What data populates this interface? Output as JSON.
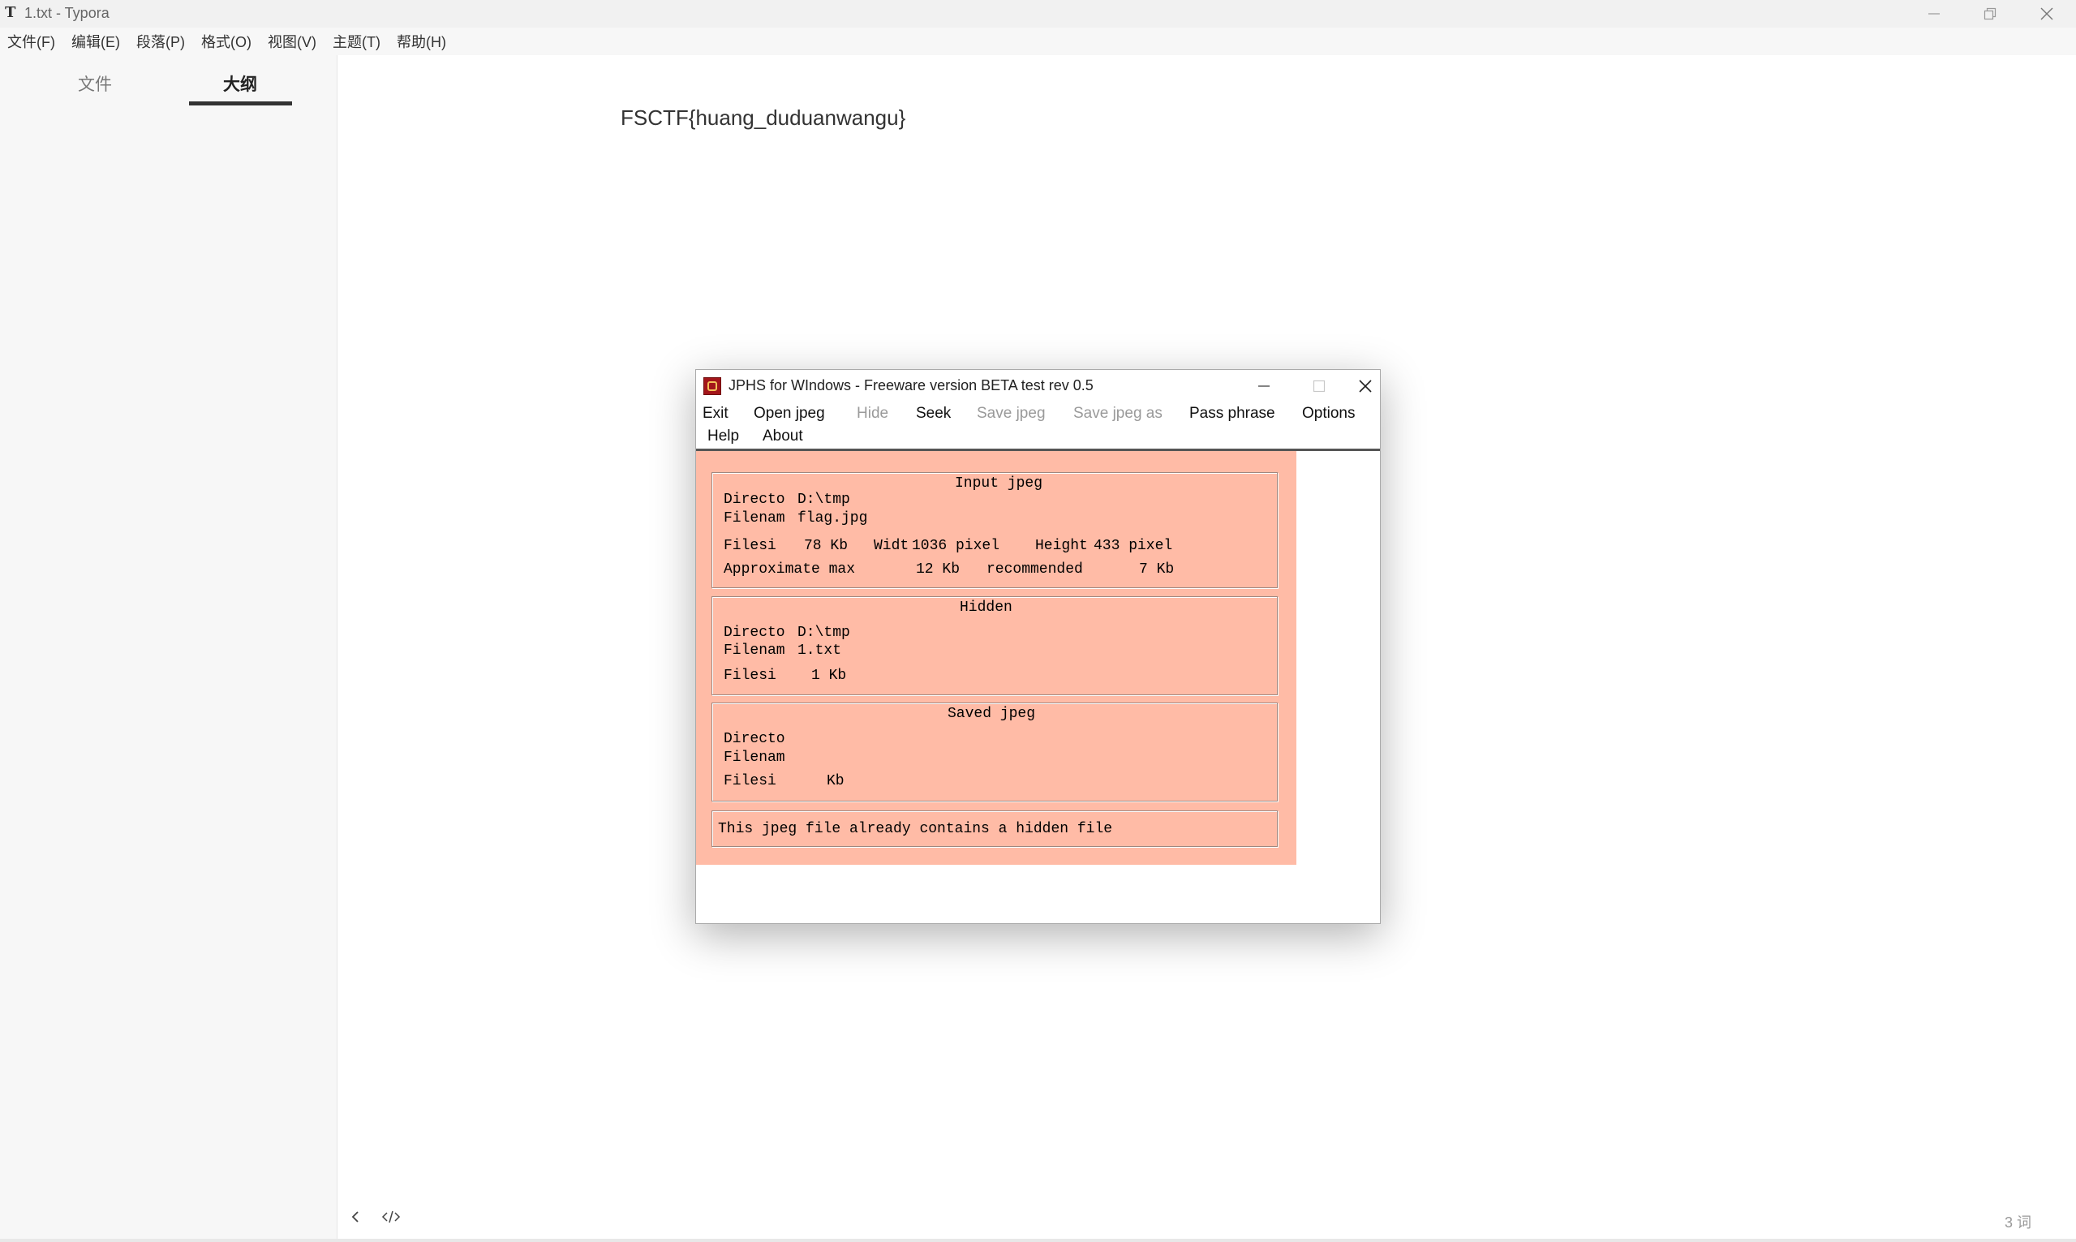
{
  "window": {
    "title": "1.txt - Typora",
    "app_icon": "T"
  },
  "menu": [
    "文件(F)",
    "编辑(E)",
    "段落(P)",
    "格式(O)",
    "视图(V)",
    "主题(T)",
    "帮助(H)"
  ],
  "sidebar": {
    "tabs": [
      "文件",
      "大纲"
    ],
    "active_tab": "大纲"
  },
  "editor": {
    "content": "FSCTF{huang_duduanwangu}"
  },
  "status": {
    "word_count": "3 词"
  },
  "jphs": {
    "title": "JPHS for WIndows - Freeware version BETA test rev 0.5",
    "menu": {
      "exit": "Exit",
      "open_jpeg": "Open jpeg",
      "hide": "Hide",
      "seek": "Seek",
      "save_jpeg": "Save jpeg",
      "save_jpeg_as": "Save jpeg as",
      "pass_phrase": "Pass phrase",
      "options": "Options",
      "help": "Help",
      "about": "About"
    },
    "input": {
      "heading": "Input jpeg",
      "dir_label": "Directo",
      "dir_value": "D:\\tmp",
      "file_label": "Filenam",
      "file_value": "flag.jpg",
      "size_label": "Filesi",
      "size_value": "78 Kb",
      "width_label": "Widt",
      "width_value": "1036 pixel",
      "height_label": "Height",
      "height_value": "433 pixel",
      "approx_label": "Approximate max",
      "approx_value": "12 Kb",
      "recommended_label": "recommended",
      "recommended_value": "7 Kb"
    },
    "hidden": {
      "heading": "Hidden",
      "dir_label": "Directo",
      "dir_value": "D:\\tmp",
      "file_label": "Filenam",
      "file_value": "1.txt",
      "size_label": "Filesi",
      "size_value": "1 Kb"
    },
    "saved": {
      "heading": "Saved jpeg",
      "dir_label": "Directo",
      "file_label": "Filenam",
      "size_label": "Filesi",
      "size_value": "Kb"
    },
    "status_message": "This jpeg file already contains a hidden file"
  }
}
